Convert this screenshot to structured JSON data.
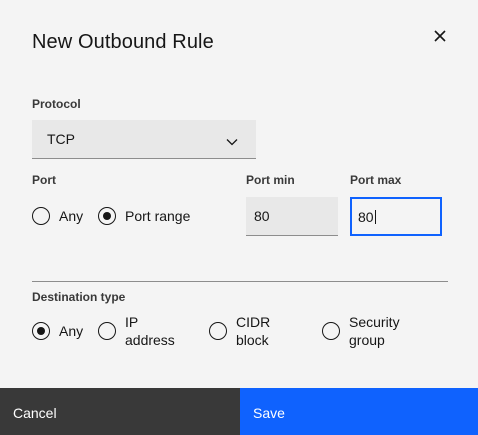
{
  "modal": {
    "title": "New Outbound Rule",
    "close_icon": "close-icon"
  },
  "protocol": {
    "label": "Protocol",
    "selected": "TCP",
    "chevron_icon": "chevron-down-icon"
  },
  "port": {
    "label": "Port",
    "options": [
      "Any",
      "Port range"
    ],
    "selected": "Port range",
    "min_label": "Port min",
    "min_value": "80",
    "max_label": "Port max",
    "max_value": "80"
  },
  "destination": {
    "label": "Destination type",
    "options": [
      {
        "line1": "Any",
        "line2": ""
      },
      {
        "line1": "IP",
        "line2": "address"
      },
      {
        "line1": "CIDR",
        "line2": "block"
      },
      {
        "line1": "Security",
        "line2": "group"
      }
    ],
    "selected": "Any"
  },
  "footer": {
    "cancel_label": "Cancel",
    "save_label": "Save"
  },
  "colors": {
    "primary": "#0f62fe",
    "secondary": "#393939",
    "background": "#f4f4f4",
    "field": "#e8e8e8"
  }
}
